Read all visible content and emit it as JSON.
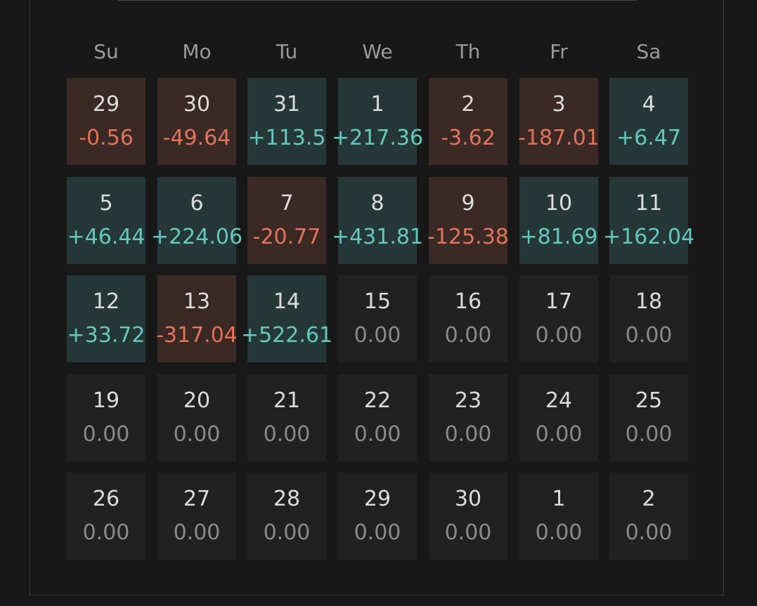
{
  "weekdays": [
    "Su",
    "Mo",
    "Tu",
    "We",
    "Th",
    "Fr",
    "Sa"
  ],
  "weeks": [
    [
      {
        "day": "29",
        "value": "-0.56",
        "status": "neg"
      },
      {
        "day": "30",
        "value": "-49.64",
        "status": "neg"
      },
      {
        "day": "31",
        "value": "+113.5",
        "status": "pos"
      },
      {
        "day": "1",
        "value": "+217.36",
        "status": "pos"
      },
      {
        "day": "2",
        "value": "-3.62",
        "status": "neg"
      },
      {
        "day": "3",
        "value": "-187.01",
        "status": "neg"
      },
      {
        "day": "4",
        "value": "+6.47",
        "status": "pos"
      }
    ],
    [
      {
        "day": "5",
        "value": "+46.44",
        "status": "pos"
      },
      {
        "day": "6",
        "value": "+224.06",
        "status": "pos"
      },
      {
        "day": "7",
        "value": "-20.77",
        "status": "neg"
      },
      {
        "day": "8",
        "value": "+431.81",
        "status": "pos"
      },
      {
        "day": "9",
        "value": "-125.38",
        "status": "neg"
      },
      {
        "day": "10",
        "value": "+81.69",
        "status": "pos"
      },
      {
        "day": "11",
        "value": "+162.04",
        "status": "pos"
      }
    ],
    [
      {
        "day": "12",
        "value": "+33.72",
        "status": "pos"
      },
      {
        "day": "13",
        "value": "-317.04",
        "status": "neg"
      },
      {
        "day": "14",
        "value": "+522.61",
        "status": "pos"
      },
      {
        "day": "15",
        "value": "0.00",
        "status": "zero"
      },
      {
        "day": "16",
        "value": "0.00",
        "status": "zero"
      },
      {
        "day": "17",
        "value": "0.00",
        "status": "zero"
      },
      {
        "day": "18",
        "value": "0.00",
        "status": "zero"
      }
    ],
    [
      {
        "day": "19",
        "value": "0.00",
        "status": "zero"
      },
      {
        "day": "20",
        "value": "0.00",
        "status": "zero"
      },
      {
        "day": "21",
        "value": "0.00",
        "status": "zero"
      },
      {
        "day": "22",
        "value": "0.00",
        "status": "zero"
      },
      {
        "day": "23",
        "value": "0.00",
        "status": "zero"
      },
      {
        "day": "24",
        "value": "0.00",
        "status": "zero"
      },
      {
        "day": "25",
        "value": "0.00",
        "status": "zero"
      }
    ],
    [
      {
        "day": "26",
        "value": "0.00",
        "status": "zero"
      },
      {
        "day": "27",
        "value": "0.00",
        "status": "zero"
      },
      {
        "day": "28",
        "value": "0.00",
        "status": "zero"
      },
      {
        "day": "29",
        "value": "0.00",
        "status": "zero"
      },
      {
        "day": "30",
        "value": "0.00",
        "status": "zero"
      },
      {
        "day": "1",
        "value": "0.00",
        "status": "zero"
      },
      {
        "day": "2",
        "value": "0.00",
        "status": "zero"
      }
    ]
  ],
  "colors": {
    "background": "#181818",
    "cell_empty": "#212121",
    "cell_positive": "#263738",
    "cell_negative": "#3a2924",
    "text_positive": "#62c9bd",
    "text_negative": "#e3735a",
    "text_zero": "#8a8a8a",
    "text_day": "#dcdcdc",
    "text_weekday": "#9a9a9a"
  }
}
